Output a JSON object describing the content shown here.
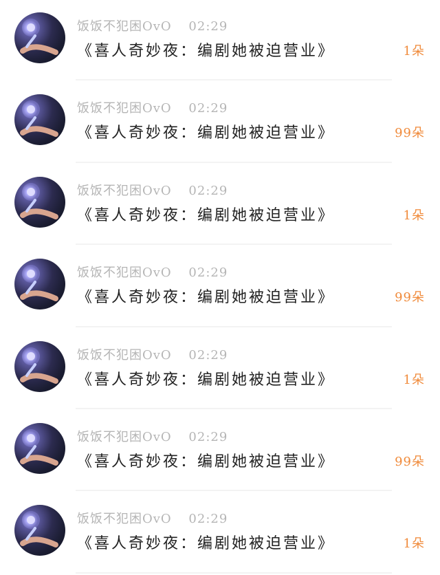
{
  "feed": {
    "items": [
      {
        "username": "饭饭不犯困OvO",
        "time": "02:29",
        "title": "《喜人奇妙夜：编剧她被迫营业》",
        "count": "1朵"
      },
      {
        "username": "饭饭不犯困OvO",
        "time": "02:29",
        "title": "《喜人奇妙夜：编剧她被迫营业》",
        "count": "99朵"
      },
      {
        "username": "饭饭不犯困OvO",
        "time": "02:29",
        "title": "《喜人奇妙夜：编剧她被迫营业》",
        "count": "1朵"
      },
      {
        "username": "饭饭不犯困OvO",
        "time": "02:29",
        "title": "《喜人奇妙夜：编剧她被迫营业》",
        "count": "99朵"
      },
      {
        "username": "饭饭不犯困OvO",
        "time": "02:29",
        "title": "《喜人奇妙夜：编剧她被迫营业》",
        "count": "1朵"
      },
      {
        "username": "饭饭不犯困OvO",
        "time": "02:29",
        "title": "《喜人奇妙夜：编剧她被迫营业》",
        "count": "99朵"
      },
      {
        "username": "饭饭不犯困OvO",
        "time": "02:29",
        "title": "《喜人奇妙夜：编剧她被迫营业》",
        "count": "1朵"
      }
    ]
  },
  "colors": {
    "username": "#b5b5b5",
    "title": "#222222",
    "count": "#f08a3a",
    "divider": "#f3f3f3"
  },
  "icons": {
    "avatar": "avatar-icon"
  }
}
